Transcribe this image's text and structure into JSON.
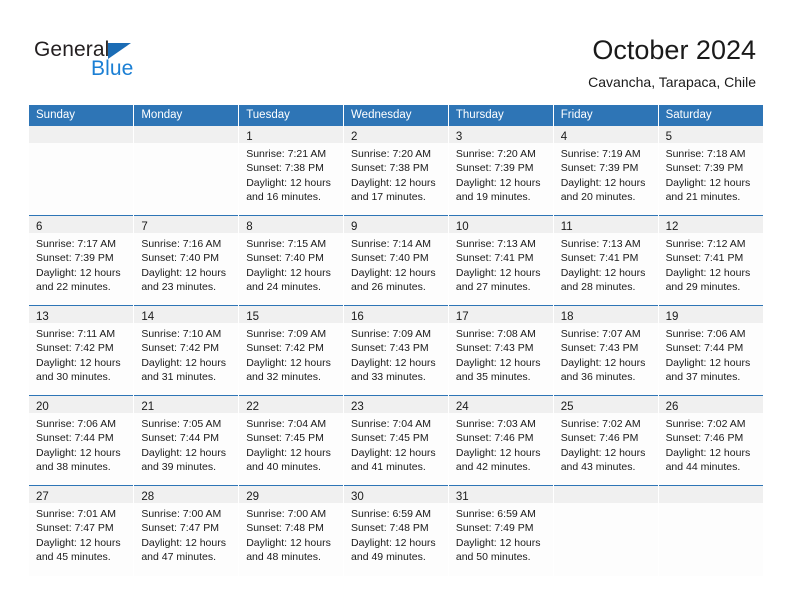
{
  "brand": {
    "name_top": "General",
    "name_bottom": "Blue",
    "triangle_color": "#1b6cb5",
    "blue_color": "#1b7fd4",
    "dark_color": "#231f20"
  },
  "header": {
    "title": "October 2024",
    "subtitle": "Cavancha, Tarapaca, Chile"
  },
  "theme": {
    "header_blue": "#2e75b6",
    "daynum_strip": "#f0f0f0",
    "cell_bg": "#fdfdfd",
    "text": "#1a1a1a"
  },
  "calendar": {
    "weekdays": [
      "Sunday",
      "Monday",
      "Tuesday",
      "Wednesday",
      "Thursday",
      "Friday",
      "Saturday"
    ],
    "weeks": [
      [
        {
          "day": "",
          "sunrise": "",
          "sunset": "",
          "daylight_line1": "",
          "daylight_line2": ""
        },
        {
          "day": "",
          "sunrise": "",
          "sunset": "",
          "daylight_line1": "",
          "daylight_line2": ""
        },
        {
          "day": "1",
          "sunrise": "Sunrise: 7:21 AM",
          "sunset": "Sunset: 7:38 PM",
          "daylight_line1": "Daylight: 12 hours",
          "daylight_line2": "and 16 minutes."
        },
        {
          "day": "2",
          "sunrise": "Sunrise: 7:20 AM",
          "sunset": "Sunset: 7:38 PM",
          "daylight_line1": "Daylight: 12 hours",
          "daylight_line2": "and 17 minutes."
        },
        {
          "day": "3",
          "sunrise": "Sunrise: 7:20 AM",
          "sunset": "Sunset: 7:39 PM",
          "daylight_line1": "Daylight: 12 hours",
          "daylight_line2": "and 19 minutes."
        },
        {
          "day": "4",
          "sunrise": "Sunrise: 7:19 AM",
          "sunset": "Sunset: 7:39 PM",
          "daylight_line1": "Daylight: 12 hours",
          "daylight_line2": "and 20 minutes."
        },
        {
          "day": "5",
          "sunrise": "Sunrise: 7:18 AM",
          "sunset": "Sunset: 7:39 PM",
          "daylight_line1": "Daylight: 12 hours",
          "daylight_line2": "and 21 minutes."
        }
      ],
      [
        {
          "day": "6",
          "sunrise": "Sunrise: 7:17 AM",
          "sunset": "Sunset: 7:39 PM",
          "daylight_line1": "Daylight: 12 hours",
          "daylight_line2": "and 22 minutes."
        },
        {
          "day": "7",
          "sunrise": "Sunrise: 7:16 AM",
          "sunset": "Sunset: 7:40 PM",
          "daylight_line1": "Daylight: 12 hours",
          "daylight_line2": "and 23 minutes."
        },
        {
          "day": "8",
          "sunrise": "Sunrise: 7:15 AM",
          "sunset": "Sunset: 7:40 PM",
          "daylight_line1": "Daylight: 12 hours",
          "daylight_line2": "and 24 minutes."
        },
        {
          "day": "9",
          "sunrise": "Sunrise: 7:14 AM",
          "sunset": "Sunset: 7:40 PM",
          "daylight_line1": "Daylight: 12 hours",
          "daylight_line2": "and 26 minutes."
        },
        {
          "day": "10",
          "sunrise": "Sunrise: 7:13 AM",
          "sunset": "Sunset: 7:41 PM",
          "daylight_line1": "Daylight: 12 hours",
          "daylight_line2": "and 27 minutes."
        },
        {
          "day": "11",
          "sunrise": "Sunrise: 7:13 AM",
          "sunset": "Sunset: 7:41 PM",
          "daylight_line1": "Daylight: 12 hours",
          "daylight_line2": "and 28 minutes."
        },
        {
          "day": "12",
          "sunrise": "Sunrise: 7:12 AM",
          "sunset": "Sunset: 7:41 PM",
          "daylight_line1": "Daylight: 12 hours",
          "daylight_line2": "and 29 minutes."
        }
      ],
      [
        {
          "day": "13",
          "sunrise": "Sunrise: 7:11 AM",
          "sunset": "Sunset: 7:42 PM",
          "daylight_line1": "Daylight: 12 hours",
          "daylight_line2": "and 30 minutes."
        },
        {
          "day": "14",
          "sunrise": "Sunrise: 7:10 AM",
          "sunset": "Sunset: 7:42 PM",
          "daylight_line1": "Daylight: 12 hours",
          "daylight_line2": "and 31 minutes."
        },
        {
          "day": "15",
          "sunrise": "Sunrise: 7:09 AM",
          "sunset": "Sunset: 7:42 PM",
          "daylight_line1": "Daylight: 12 hours",
          "daylight_line2": "and 32 minutes."
        },
        {
          "day": "16",
          "sunrise": "Sunrise: 7:09 AM",
          "sunset": "Sunset: 7:43 PM",
          "daylight_line1": "Daylight: 12 hours",
          "daylight_line2": "and 33 minutes."
        },
        {
          "day": "17",
          "sunrise": "Sunrise: 7:08 AM",
          "sunset": "Sunset: 7:43 PM",
          "daylight_line1": "Daylight: 12 hours",
          "daylight_line2": "and 35 minutes."
        },
        {
          "day": "18",
          "sunrise": "Sunrise: 7:07 AM",
          "sunset": "Sunset: 7:43 PM",
          "daylight_line1": "Daylight: 12 hours",
          "daylight_line2": "and 36 minutes."
        },
        {
          "day": "19",
          "sunrise": "Sunrise: 7:06 AM",
          "sunset": "Sunset: 7:44 PM",
          "daylight_line1": "Daylight: 12 hours",
          "daylight_line2": "and 37 minutes."
        }
      ],
      [
        {
          "day": "20",
          "sunrise": "Sunrise: 7:06 AM",
          "sunset": "Sunset: 7:44 PM",
          "daylight_line1": "Daylight: 12 hours",
          "daylight_line2": "and 38 minutes."
        },
        {
          "day": "21",
          "sunrise": "Sunrise: 7:05 AM",
          "sunset": "Sunset: 7:44 PM",
          "daylight_line1": "Daylight: 12 hours",
          "daylight_line2": "and 39 minutes."
        },
        {
          "day": "22",
          "sunrise": "Sunrise: 7:04 AM",
          "sunset": "Sunset: 7:45 PM",
          "daylight_line1": "Daylight: 12 hours",
          "daylight_line2": "and 40 minutes."
        },
        {
          "day": "23",
          "sunrise": "Sunrise: 7:04 AM",
          "sunset": "Sunset: 7:45 PM",
          "daylight_line1": "Daylight: 12 hours",
          "daylight_line2": "and 41 minutes."
        },
        {
          "day": "24",
          "sunrise": "Sunrise: 7:03 AM",
          "sunset": "Sunset: 7:46 PM",
          "daylight_line1": "Daylight: 12 hours",
          "daylight_line2": "and 42 minutes."
        },
        {
          "day": "25",
          "sunrise": "Sunrise: 7:02 AM",
          "sunset": "Sunset: 7:46 PM",
          "daylight_line1": "Daylight: 12 hours",
          "daylight_line2": "and 43 minutes."
        },
        {
          "day": "26",
          "sunrise": "Sunrise: 7:02 AM",
          "sunset": "Sunset: 7:46 PM",
          "daylight_line1": "Daylight: 12 hours",
          "daylight_line2": "and 44 minutes."
        }
      ],
      [
        {
          "day": "27",
          "sunrise": "Sunrise: 7:01 AM",
          "sunset": "Sunset: 7:47 PM",
          "daylight_line1": "Daylight: 12 hours",
          "daylight_line2": "and 45 minutes."
        },
        {
          "day": "28",
          "sunrise": "Sunrise: 7:00 AM",
          "sunset": "Sunset: 7:47 PM",
          "daylight_line1": "Daylight: 12 hours",
          "daylight_line2": "and 47 minutes."
        },
        {
          "day": "29",
          "sunrise": "Sunrise: 7:00 AM",
          "sunset": "Sunset: 7:48 PM",
          "daylight_line1": "Daylight: 12 hours",
          "daylight_line2": "and 48 minutes."
        },
        {
          "day": "30",
          "sunrise": "Sunrise: 6:59 AM",
          "sunset": "Sunset: 7:48 PM",
          "daylight_line1": "Daylight: 12 hours",
          "daylight_line2": "and 49 minutes."
        },
        {
          "day": "31",
          "sunrise": "Sunrise: 6:59 AM",
          "sunset": "Sunset: 7:49 PM",
          "daylight_line1": "Daylight: 12 hours",
          "daylight_line2": "and 50 minutes."
        },
        {
          "day": "",
          "sunrise": "",
          "sunset": "",
          "daylight_line1": "",
          "daylight_line2": ""
        },
        {
          "day": "",
          "sunrise": "",
          "sunset": "",
          "daylight_line1": "",
          "daylight_line2": ""
        }
      ]
    ]
  }
}
